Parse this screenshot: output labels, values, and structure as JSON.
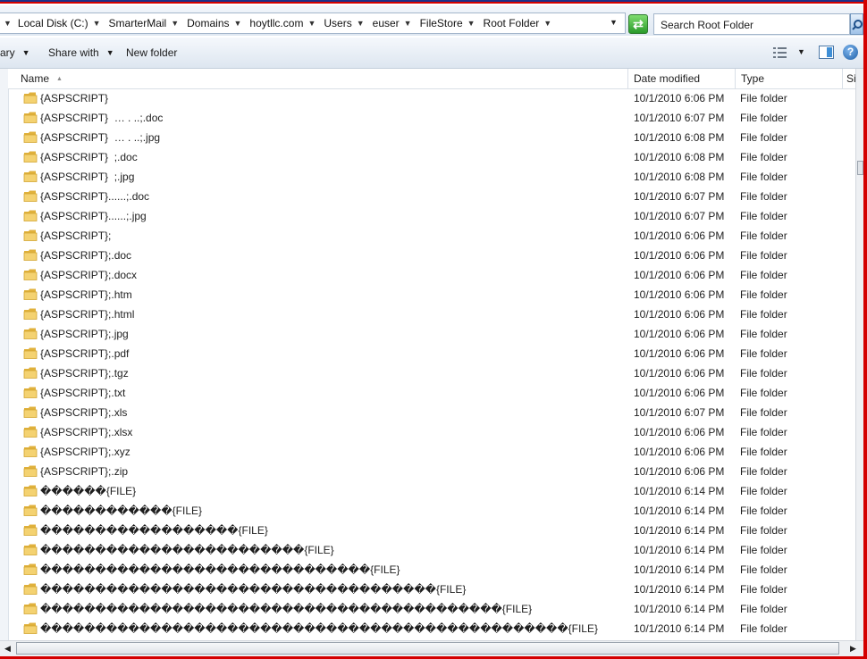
{
  "breadcrumbs": [
    "Local Disk (C:)",
    "SmarterMail",
    "Domains",
    "hoytllc.com",
    "Users",
    "euser",
    "FileStore",
    "Root Folder"
  ],
  "search": {
    "placeholder": "Search Root Folder"
  },
  "toolbar": {
    "library_label": "ary",
    "share_label": "Share with",
    "new_folder_label": "New folder"
  },
  "columns": {
    "name": "Name",
    "date": "Date modified",
    "type": "Type",
    "size": "Siz"
  },
  "files": [
    {
      "name": "{ASPSCRIPT}",
      "date": "10/1/2010 6:06 PM",
      "type": "File folder"
    },
    {
      "name": "{ASPSCRIPT}  … . ..;.doc",
      "date": "10/1/2010 6:07 PM",
      "type": "File folder"
    },
    {
      "name": "{ASPSCRIPT}  … . ..;.jpg",
      "date": "10/1/2010 6:08 PM",
      "type": "File folder"
    },
    {
      "name": "{ASPSCRIPT}  ;.doc",
      "date": "10/1/2010 6:08 PM",
      "type": "File folder"
    },
    {
      "name": "{ASPSCRIPT}  ;.jpg",
      "date": "10/1/2010 6:08 PM",
      "type": "File folder"
    },
    {
      "name": "{ASPSCRIPT}......;.doc",
      "date": "10/1/2010 6:07 PM",
      "type": "File folder"
    },
    {
      "name": "{ASPSCRIPT}......;.jpg",
      "date": "10/1/2010 6:07 PM",
      "type": "File folder"
    },
    {
      "name": "{ASPSCRIPT};",
      "date": "10/1/2010 6:06 PM",
      "type": "File folder"
    },
    {
      "name": "{ASPSCRIPT};.doc",
      "date": "10/1/2010 6:06 PM",
      "type": "File folder"
    },
    {
      "name": "{ASPSCRIPT};.docx",
      "date": "10/1/2010 6:06 PM",
      "type": "File folder"
    },
    {
      "name": "{ASPSCRIPT};.htm",
      "date": "10/1/2010 6:06 PM",
      "type": "File folder"
    },
    {
      "name": "{ASPSCRIPT};.html",
      "date": "10/1/2010 6:06 PM",
      "type": "File folder"
    },
    {
      "name": "{ASPSCRIPT};.jpg",
      "date": "10/1/2010 6:06 PM",
      "type": "File folder"
    },
    {
      "name": "{ASPSCRIPT};.pdf",
      "date": "10/1/2010 6:06 PM",
      "type": "File folder"
    },
    {
      "name": "{ASPSCRIPT};.tgz",
      "date": "10/1/2010 6:06 PM",
      "type": "File folder"
    },
    {
      "name": "{ASPSCRIPT};.txt",
      "date": "10/1/2010 6:06 PM",
      "type": "File folder"
    },
    {
      "name": "{ASPSCRIPT};.xls",
      "date": "10/1/2010 6:07 PM",
      "type": "File folder"
    },
    {
      "name": "{ASPSCRIPT};.xlsx",
      "date": "10/1/2010 6:06 PM",
      "type": "File folder"
    },
    {
      "name": "{ASPSCRIPT};.xyz",
      "date": "10/1/2010 6:06 PM",
      "type": "File folder"
    },
    {
      "name": "{ASPSCRIPT};.zip",
      "date": "10/1/2010 6:06 PM",
      "type": "File folder"
    },
    {
      "name": "������{FILE}",
      "date": "10/1/2010 6:14 PM",
      "type": "File folder"
    },
    {
      "name": "������������{FILE}",
      "date": "10/1/2010 6:14 PM",
      "type": "File folder"
    },
    {
      "name": "������������������{FILE}",
      "date": "10/1/2010 6:14 PM",
      "type": "File folder"
    },
    {
      "name": "������������������������{FILE}",
      "date": "10/1/2010 6:14 PM",
      "type": "File folder"
    },
    {
      "name": "������������������������������{FILE}",
      "date": "10/1/2010 6:14 PM",
      "type": "File folder"
    },
    {
      "name": "������������������������������������{FILE}",
      "date": "10/1/2010 6:14 PM",
      "type": "File folder"
    },
    {
      "name": "������������������������������������������{FILE}",
      "date": "10/1/2010 6:14 PM",
      "type": "File folder"
    },
    {
      "name": "������������������������������������������������{FILE}",
      "date": "10/1/2010 6:14 PM",
      "type": "File folder"
    }
  ],
  "icons": {
    "folder": "folder-icon",
    "go": "go-arrow-icon",
    "search": "search-icon",
    "views": "views-icon",
    "preview_pane": "preview-pane-icon",
    "help": "help-icon"
  },
  "colors": {
    "frame": "#d40000",
    "folder": "#f2c94c",
    "go_button": "#2a9a2b"
  }
}
